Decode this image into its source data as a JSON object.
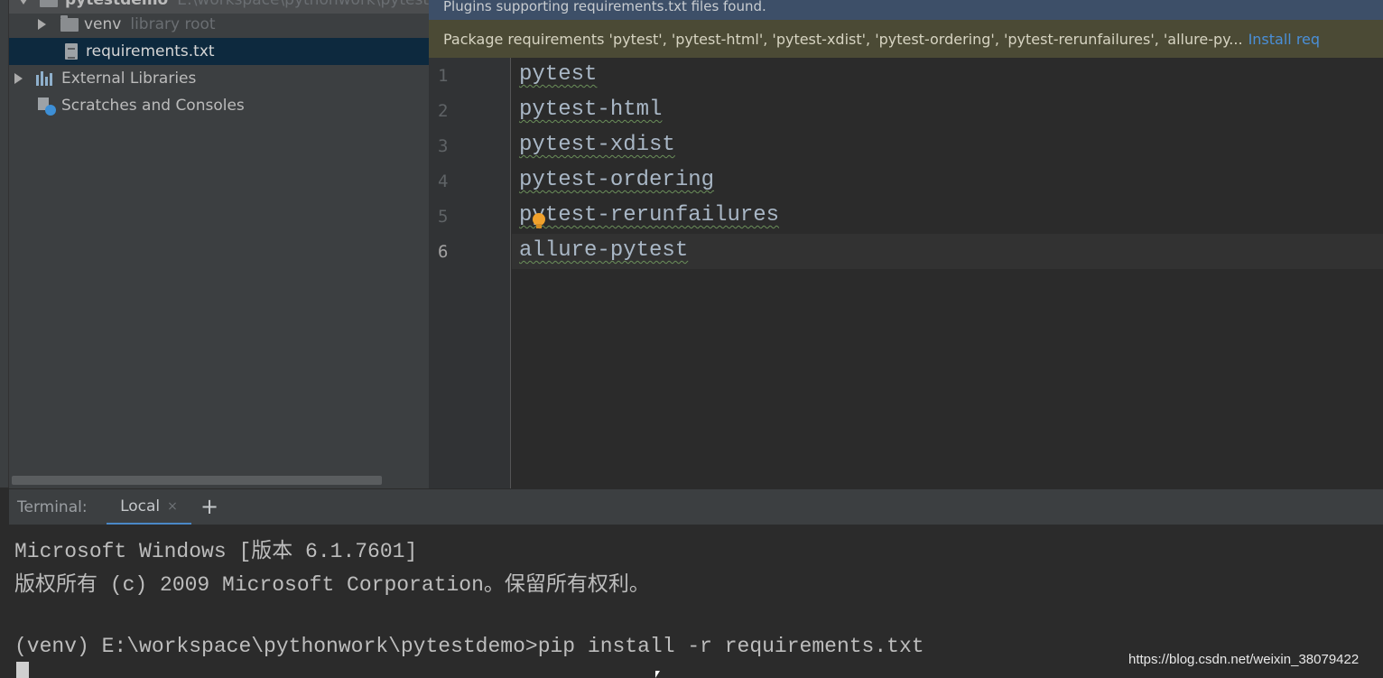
{
  "project_tree": {
    "root_label": "pytestdemo",
    "root_path": "E:\\workspace\\pythonwork\\pytest",
    "items": [
      {
        "label": "venv",
        "sublabel": "library root"
      },
      {
        "label": "requirements.txt"
      },
      {
        "label": "External Libraries"
      },
      {
        "label": "Scratches and Consoles"
      }
    ]
  },
  "editor": {
    "banner_plugins": "Plugins supporting requirements.txt files found.",
    "banner_packages": "Package requirements 'pytest', 'pytest-html', 'pytest-xdist', 'pytest-ordering', 'pytest-rerunfailures', 'allure-py...",
    "install_link": "Install req",
    "line_numbers": [
      "1",
      "2",
      "3",
      "4",
      "5",
      "6"
    ],
    "lines": [
      "pytest",
      "pytest-html",
      "pytest-xdist",
      "pytest-ordering",
      "pytest-rerunfailures",
      "allure-pytest"
    ]
  },
  "terminal": {
    "title": "Terminal:",
    "tab_label": "Local",
    "tab_close": "×",
    "add_label": "+",
    "lines": [
      "Microsoft Windows [版本 6.1.7601]",
      "版权所有 (c) 2009 Microsoft Corporation。保留所有权利。",
      "",
      "(venv) E:\\workspace\\pythonwork\\pytestdemo>pip install -r requirements.txt"
    ]
  },
  "watermark": "https://blog.csdn.net/weixin_38079422",
  "icons": {
    "tree_expand": "chevron-right-icon",
    "folder": "folder-icon",
    "file": "text-file-icon",
    "libraries": "library-icon",
    "scratches": "scratch-icon",
    "intention": "lightbulb-icon"
  }
}
